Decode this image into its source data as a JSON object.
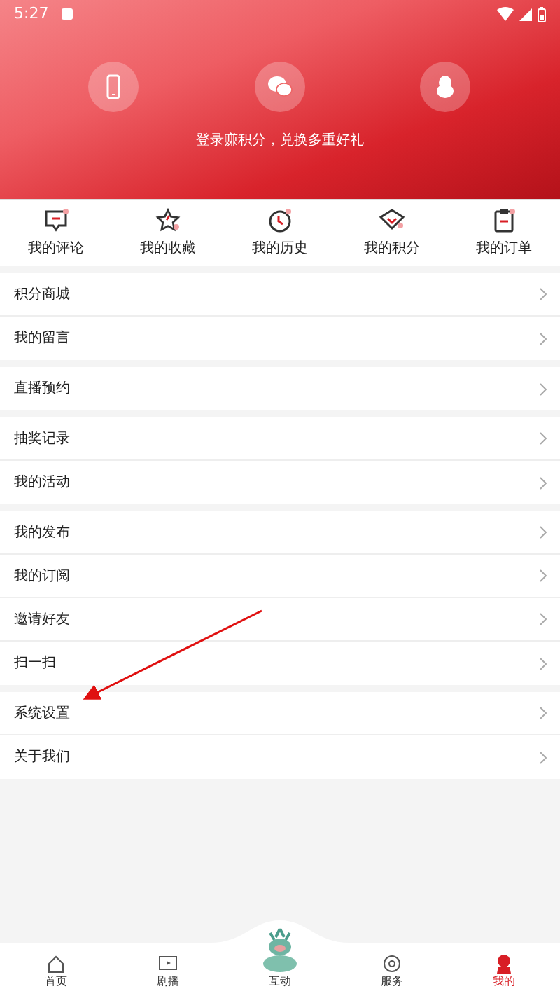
{
  "status_bar": {
    "time": "5:27"
  },
  "header": {
    "prompt": "登录赚积分，兑换多重好礼"
  },
  "shortcuts": [
    {
      "label": "我的评论"
    },
    {
      "label": "我的收藏"
    },
    {
      "label": "我的历史"
    },
    {
      "label": "我的积分"
    },
    {
      "label": "我的订单"
    }
  ],
  "menu_groups": [
    {
      "items": [
        {
          "label": "积分商城"
        },
        {
          "label": "我的留言"
        }
      ]
    },
    {
      "items": [
        {
          "label": "直播预约"
        }
      ]
    },
    {
      "items": [
        {
          "label": "抽奖记录"
        },
        {
          "label": "我的活动"
        }
      ]
    },
    {
      "items": [
        {
          "label": "我的发布"
        },
        {
          "label": "我的订阅"
        },
        {
          "label": "邀请好友"
        },
        {
          "label": "扫一扫"
        }
      ]
    },
    {
      "items": [
        {
          "label": "系统设置"
        },
        {
          "label": "关于我们"
        }
      ]
    }
  ],
  "bottom_nav": [
    {
      "label": "首页",
      "selected": false
    },
    {
      "label": "剧播",
      "selected": false
    },
    {
      "label": "互动",
      "selected": false
    },
    {
      "label": "服务",
      "selected": false
    },
    {
      "label": "我的",
      "selected": true
    }
  ]
}
